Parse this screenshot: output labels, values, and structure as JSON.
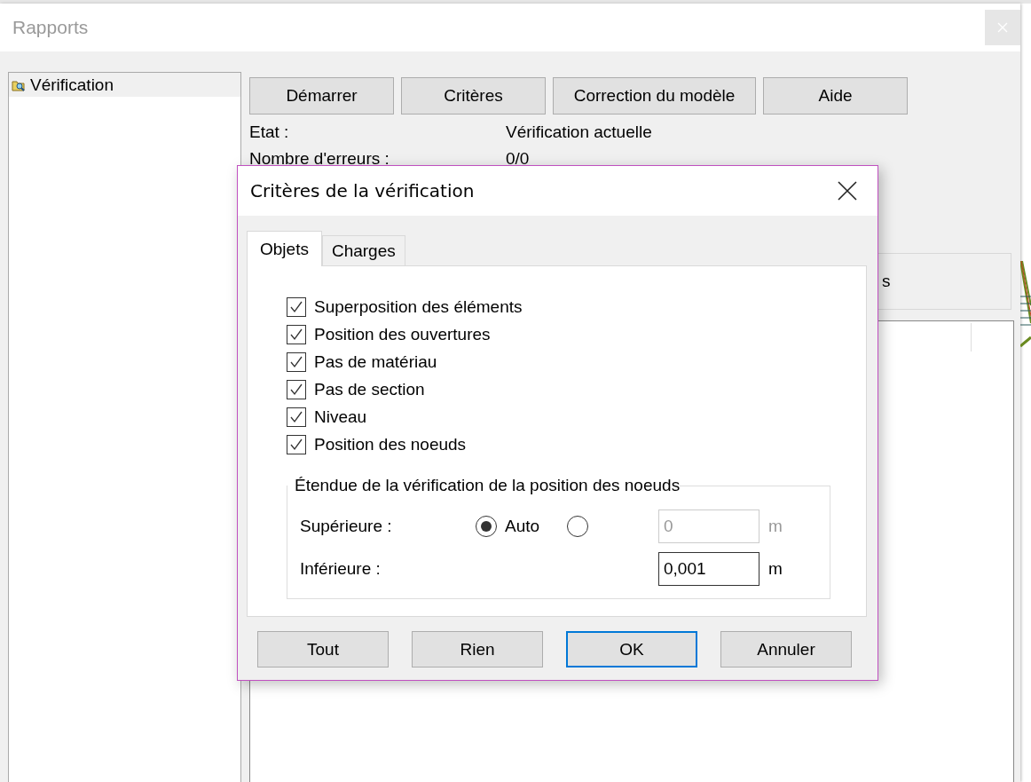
{
  "window": {
    "title": "Rapports"
  },
  "sidebar": {
    "items": [
      {
        "label": "Vérification",
        "selected": true
      }
    ]
  },
  "toolbar": {
    "buttons": [
      "Démarrer",
      "Critères",
      "Correction du modèle",
      "Aide"
    ]
  },
  "status": [
    {
      "label": "Etat :",
      "value": "Vérification actuelle"
    },
    {
      "label": "Nombre d'erreurs :",
      "value": "0/0"
    }
  ],
  "partial_button": {
    "label": "s"
  },
  "dialog": {
    "title": "Critères de la vérification",
    "tabs": [
      {
        "label": "Objets",
        "selected": true
      },
      {
        "label": "Charges",
        "selected": false
      }
    ],
    "checks": [
      {
        "label": "Superposition des éléments",
        "checked": true
      },
      {
        "label": "Position des ouvertures",
        "checked": true
      },
      {
        "label": "Pas de matériau",
        "checked": true
      },
      {
        "label": "Pas de section",
        "checked": true
      },
      {
        "label": "Niveau",
        "checked": true
      },
      {
        "label": "Position des noeuds",
        "checked": true
      }
    ],
    "group": {
      "legend": "Étendue de la vérification de la position des noeuds",
      "rows": [
        {
          "label": "Supérieure :",
          "radios": [
            {
              "label": "Auto",
              "selected": true
            },
            {
              "selected": false
            }
          ],
          "field": {
            "value": "0",
            "disabled": true
          },
          "unit": "m"
        },
        {
          "label": "Inférieure :",
          "field": {
            "value": "0,001",
            "disabled": false
          },
          "unit": "m"
        }
      ]
    },
    "buttons": [
      {
        "label": "Tout",
        "default": false
      },
      {
        "label": "Rien",
        "default": false
      },
      {
        "label": "OK",
        "default": true
      },
      {
        "label": "Annuler",
        "default": false
      }
    ]
  }
}
